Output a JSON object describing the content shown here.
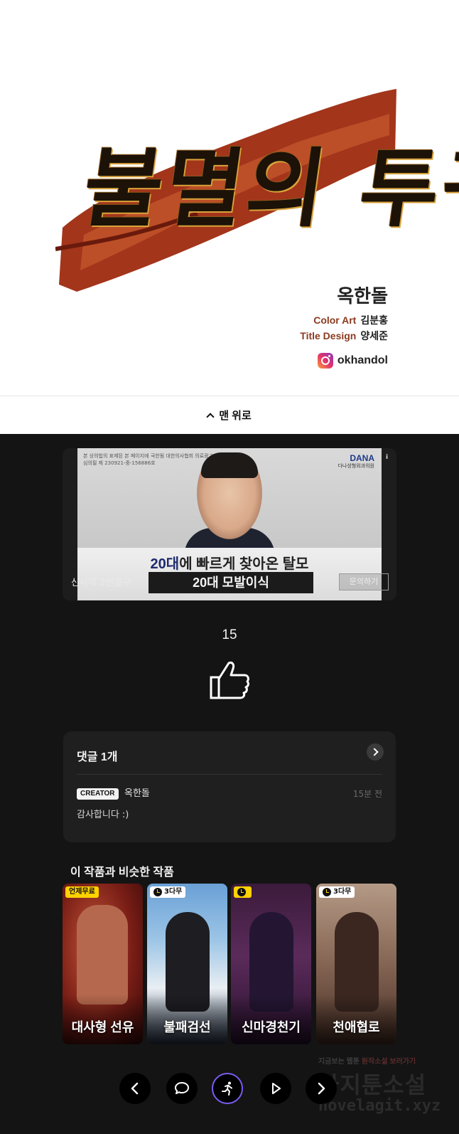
{
  "credits": {
    "title": "불멸의 투귀",
    "author": "옥한돌",
    "roles": [
      {
        "role": "Color Art",
        "name": "김분홍"
      },
      {
        "role": "Title Design",
        "name": "양세준"
      }
    ],
    "instagram_handle": "okhandol"
  },
  "back_to_top": {
    "label": "맨 위로"
  },
  "ad": {
    "fine_print": "본 상의법의 표제된 본 페이지에 국한됨 대한의사협회 의료광고 심의필 제 230921-중-156886호",
    "brand": "DANA",
    "brand_sub": "다나성형외과의원",
    "headline_highlight": "20대",
    "headline_rest": "에 빠르게 찾아온 탈모",
    "pill": "20대 모발이식",
    "location": "신사역 2번출구",
    "cta": "문의하기"
  },
  "likes": {
    "count": "15"
  },
  "comments": {
    "title": "댓글 1개",
    "items": [
      {
        "badge": "CREATOR",
        "author": "옥한돌",
        "time": "15분 전",
        "body": "감사합니다 :)"
      }
    ]
  },
  "recommendations": {
    "title": "이 작품과 비슷한 작품",
    "items": [
      {
        "name": "대사형 선유",
        "badge": "언제무료"
      },
      {
        "name": "불패검선",
        "badge": "3다무"
      },
      {
        "name": "신마경천기",
        "badge": ""
      },
      {
        "name": "천애협로",
        "badge": "3다무"
      }
    ]
  },
  "watermark": {
    "line1_a": "지금보는 웹툰",
    "line1_b": "원작소설 보러가기",
    "brand": "아지툰소설",
    "url": "novelagit.xyz"
  },
  "colors": {
    "accent": "#7a5cf0",
    "badge_yellow": "#ffd200",
    "role_color": "#8b3a1f"
  }
}
